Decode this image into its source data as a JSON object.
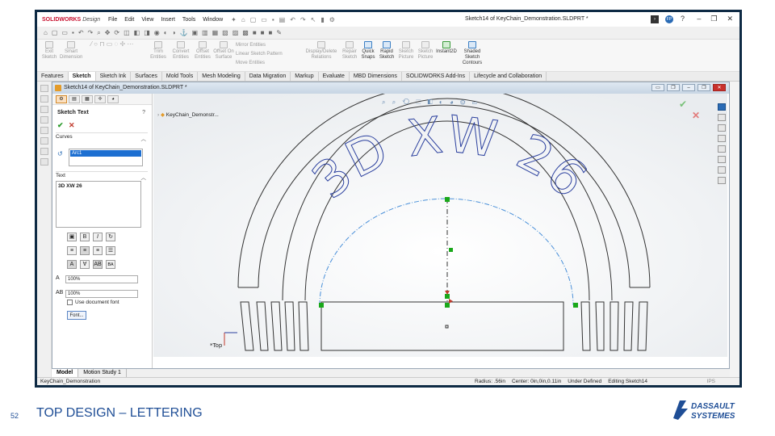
{
  "app": {
    "logo_text": "SOLIDWORKS",
    "logo_suffix": "Design",
    "menu": [
      "File",
      "Edit",
      "View",
      "Insert",
      "Tools",
      "Window"
    ],
    "document_title": "Sketch14 of KeyChain_Demonstration.SLDPRT *"
  },
  "ribbon": {
    "groups": [
      {
        "label": "Exit Sketch",
        "state": "disabled"
      },
      {
        "label": "Smart Dimension",
        "state": "disabled"
      },
      {
        "label": "Trim Entities",
        "state": "disabled"
      },
      {
        "label": "Convert Entities",
        "state": "disabled"
      },
      {
        "label": "Offset Entities",
        "state": "disabled"
      },
      {
        "label": "Offset On Surface",
        "state": "disabled"
      },
      {
        "label": "Mirror Entities",
        "state": "disabled"
      },
      {
        "label": "Linear Sketch Pattern",
        "state": "disabled"
      },
      {
        "label": "Move Entities",
        "state": "disabled"
      },
      {
        "label": "Display/Delete Relations",
        "state": "disabled"
      },
      {
        "label": "Repair Sketch",
        "state": "disabled"
      },
      {
        "label": "Quick Snaps",
        "state": "enabled"
      },
      {
        "label": "Rapid Sketch",
        "state": "enabled"
      },
      {
        "label": "Sketch Picture",
        "state": "disabled"
      },
      {
        "label": "Sketch Picture",
        "state": "disabled"
      },
      {
        "label": "Instant2D",
        "state": "enabled"
      },
      {
        "label": "Shaded Sketch Contours",
        "state": "enabled"
      }
    ]
  },
  "tabs": [
    "Features",
    "Sketch",
    "Sketch Ink",
    "Surfaces",
    "Mold Tools",
    "Mesh Modeling",
    "Data Migration",
    "Markup",
    "Evaluate",
    "MBD Dimensions",
    "SOLIDWORKS Add-Ins",
    "Lifecycle and Collaboration"
  ],
  "active_tab": "Sketch",
  "doc_window": {
    "title": "Sketch14 of KeyChain_Demonstration.SLDPRT *",
    "tree_item": "KeyChain_Demonstr..."
  },
  "property_manager": {
    "title": "Sketch Text",
    "help": "?",
    "curves_label": "Curves",
    "curve_item": "Arc1",
    "text_label": "Text",
    "text_value": "3D XW 26",
    "width_value": "100%",
    "spacing_value": "100%",
    "use_doc_font": "Use document font",
    "font_button": "Font...",
    "bold": "B",
    "italic": "I"
  },
  "sketch_text": "3D XW 26",
  "view_label": "*Top",
  "bottom_tabs": [
    "Model",
    "Motion Study 1"
  ],
  "status": {
    "left": "KeyChain_Demonstration",
    "radius": "Radius: .56in",
    "center": "Center: 0in,0in,0.11in",
    "state": "Under Defined",
    "editing": "Editing Sketch14",
    "units": "IPS"
  },
  "slide": {
    "number": "52",
    "title": "TOP DESIGN – LETTERING",
    "brand_line1": "DASSAULT",
    "brand_line2": "SYSTEMES"
  },
  "colors": {
    "brand_blue": "#1f4e96",
    "sketch_blue": "#2a3f9e",
    "arc_blue": "#4a90d9",
    "constraint_green": "#1aa81a",
    "selection_blue": "#1d6fd1"
  }
}
